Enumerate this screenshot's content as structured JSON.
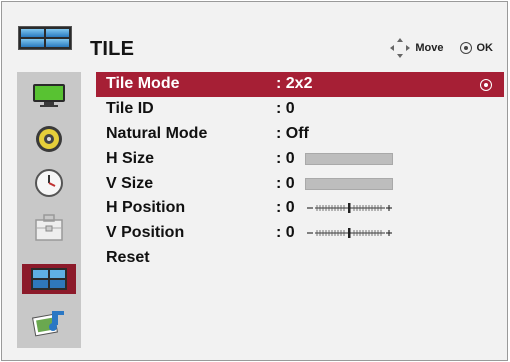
{
  "header": {
    "title": "TILE",
    "move_label": "Move",
    "ok_label": "OK"
  },
  "sidebar": {
    "items": [
      {
        "icon": "picture-tv-icon"
      },
      {
        "icon": "audio-speaker-icon"
      },
      {
        "icon": "time-clock-icon"
      },
      {
        "icon": "option-toolbox-icon"
      },
      {
        "icon": "tile-icon",
        "active": true
      },
      {
        "icon": "media-photo-icon"
      }
    ]
  },
  "menu": {
    "rows": [
      {
        "label": "Tile Mode",
        "value": ": 2x2"
      },
      {
        "label": "Tile ID",
        "value": ": 0"
      },
      {
        "label": "Natural Mode",
        "value": ": Off"
      },
      {
        "label": "H Size",
        "value": ": 0",
        "level": 0
      },
      {
        "label": "V Size",
        "value": ": 0",
        "level": 0
      },
      {
        "label": "H Position",
        "value": ": 0",
        "position": 0
      },
      {
        "label": "V Position",
        "value": ": 0",
        "position": 0
      },
      {
        "label": "Reset"
      }
    ]
  },
  "colors": {
    "selected_row": "#a61f35",
    "active_sidebar": "#8c1a2a",
    "panel": "#f2f2f2",
    "sidebar": "#c8c8c8"
  }
}
